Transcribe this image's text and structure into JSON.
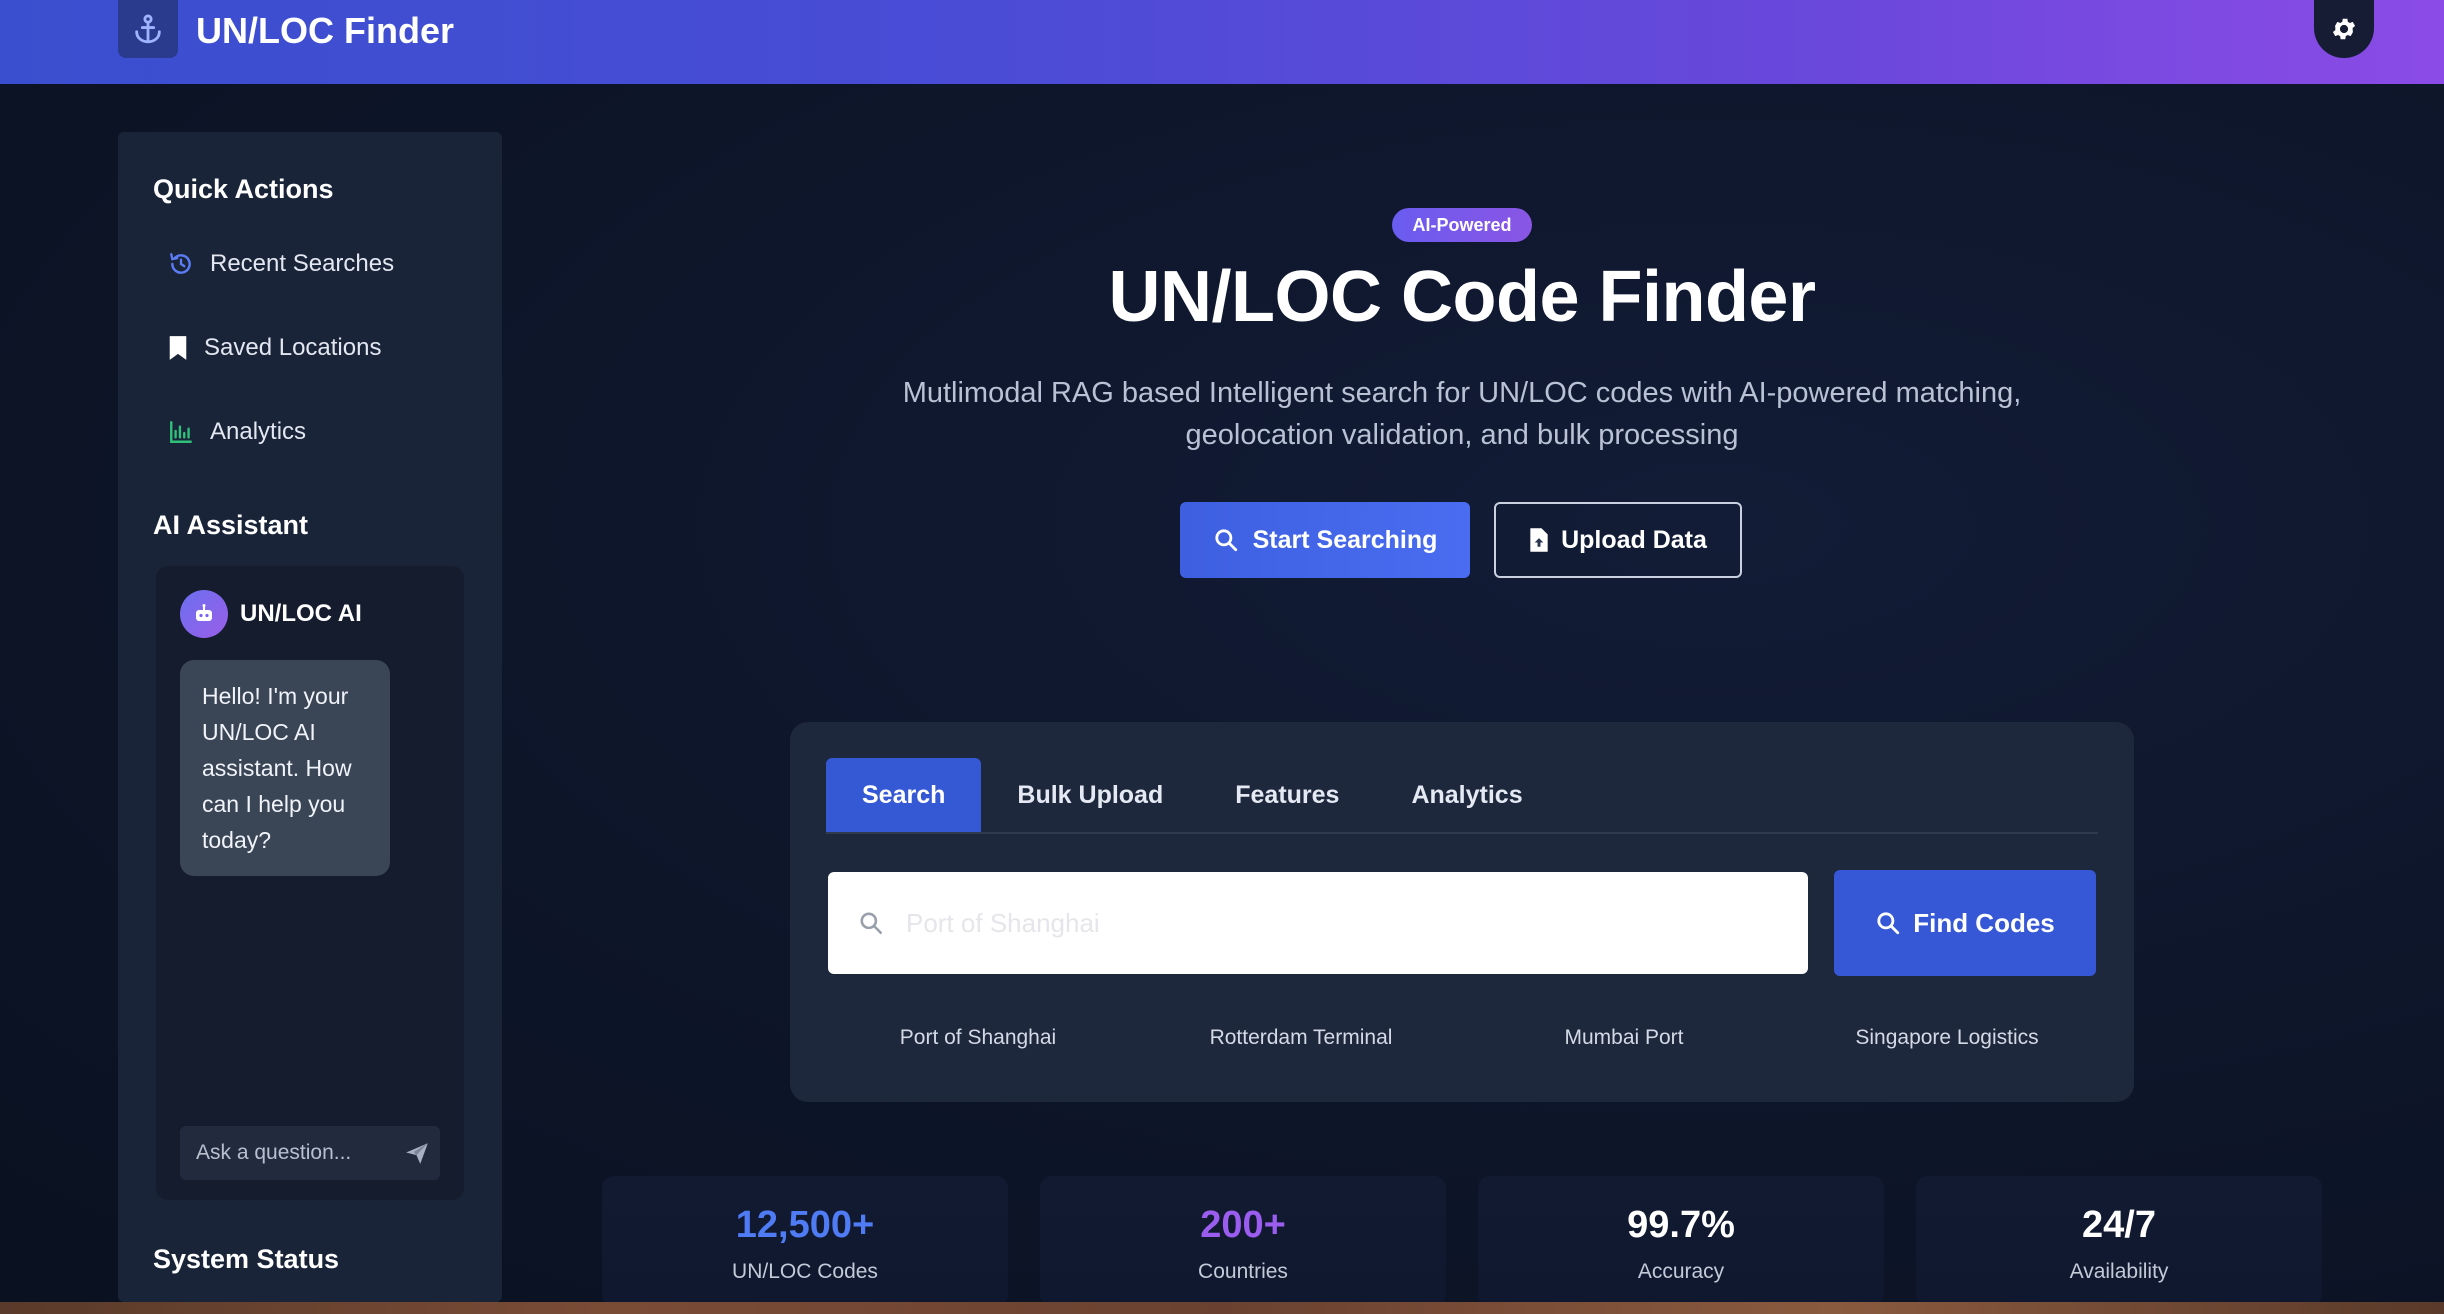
{
  "header": {
    "title": "UN/LOC Finder",
    "logo_icon": "anchor-icon",
    "settings_icon": "gear-icon"
  },
  "sidebar": {
    "quick_actions_title": "Quick Actions",
    "items": [
      {
        "label": "Recent Searches",
        "icon": "history-icon"
      },
      {
        "label": "Saved Locations",
        "icon": "bookmark-icon"
      },
      {
        "label": "Analytics",
        "icon": "chart-icon"
      }
    ],
    "assistant_title": "AI Assistant",
    "assistant": {
      "name": "UN/LOC AI",
      "message": "Hello! I'm your UN/LOC AI assistant. How can I help you today?",
      "input_placeholder": "Ask a question..."
    },
    "status_title": "System Status"
  },
  "hero": {
    "badge": "AI-Powered",
    "title": "UN/LOC Code Finder",
    "subtitle_line1": "Mutlimodal RAG based Intelligent search for UN/LOC codes with AI-powered matching,",
    "subtitle_line2": "geolocation validation, and bulk processing",
    "primary_button": "Start Searching",
    "secondary_button": "Upload Data"
  },
  "search_panel": {
    "tabs": [
      "Search",
      "Bulk Upload",
      "Features",
      "Analytics"
    ],
    "active_tab": "Search",
    "input_placeholder": "Port of Shanghai",
    "find_button": "Find Codes",
    "suggestions": [
      "Port of Shanghai",
      "Rotterdam Terminal",
      "Mumbai Port",
      "Singapore Logistics"
    ]
  },
  "stats": [
    {
      "value": "12,500+",
      "label": "UN/LOC Codes",
      "color": "#4f7cf5"
    },
    {
      "value": "200+",
      "label": "Countries",
      "color": "#9b5cf0"
    },
    {
      "value": "99.7%",
      "label": "Accuracy",
      "color": "#ffffff"
    },
    {
      "value": "24/7",
      "label": "Availability",
      "color": "#ffffff"
    }
  ],
  "colors": {
    "accent": "#3658d6",
    "header_start": "#3a4fcf",
    "header_end": "#8b4be6",
    "background": "#0d1529"
  }
}
